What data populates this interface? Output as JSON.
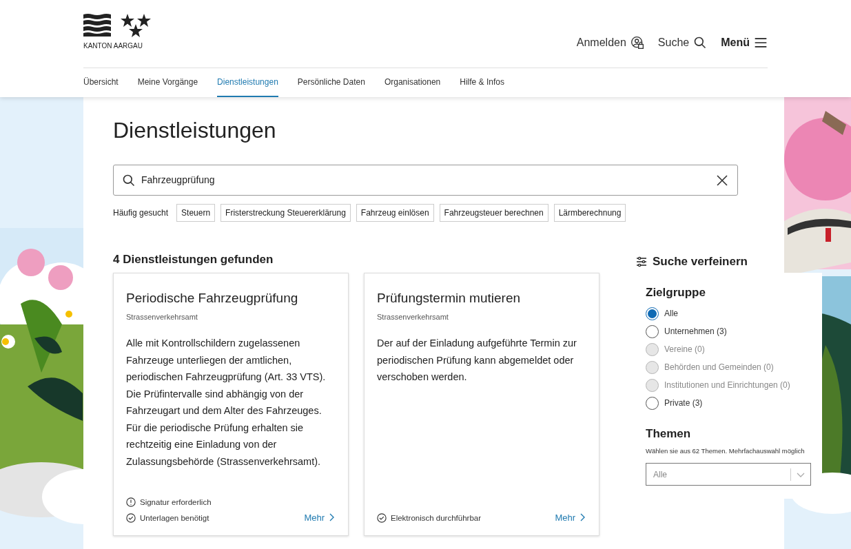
{
  "header": {
    "logo_text": "KANTON AARGAU",
    "actions": [
      {
        "kind": "login",
        "label": "Anmelden"
      },
      {
        "kind": "search",
        "label": "Suche"
      },
      {
        "kind": "menu",
        "label": "Menü"
      }
    ]
  },
  "nav": [
    {
      "label": "Übersicht",
      "selected": false
    },
    {
      "label": "Meine Vorgänge",
      "selected": false
    },
    {
      "label": "Dienstleistungen",
      "selected": true
    },
    {
      "label": "Persönliche Daten",
      "selected": false
    },
    {
      "label": "Organisationen",
      "selected": false
    },
    {
      "label": "Hilfe & Infos",
      "selected": false
    }
  ],
  "page_title": "Dienstleistungen",
  "search": {
    "value": "Fahrzeugprüfung"
  },
  "frequent": {
    "label": "Häufig gesucht",
    "tags": [
      "Steuern",
      "Fristerstreckung Steuererklärung",
      "Fahrzeug einlösen",
      "Fahrzeugsteuer berechnen",
      "Lärmberechnung"
    ]
  },
  "results_title": "4 Dienstleistungen gefunden",
  "cards": [
    {
      "title": "Periodische Fahrzeugprüfung",
      "office": "Strassenverkehrsamt",
      "text": "Alle mit Kontrollschildern zugelassenen Fahrzeuge unterliegen der amtlichen, periodischen Fahrzeugprüfung (Art. 33 VTS). Die Prüfintervalle sind abhängig von der Fahrzeugart und dem Alter des Fahrzeuges. Für die periodische Prüfung erhalten sie rechtzeitig eine Einladung von der Zulassungsbehörde (Strassenverkehrsamt).",
      "features": [
        {
          "kind": "warning",
          "label": "Signatur erforderlich"
        },
        {
          "kind": "check",
          "label": "Unterlagen benötigt"
        }
      ],
      "link": "Mehr"
    },
    {
      "title": "Prüfungstermin mutieren",
      "office": "Strassenverkehrsamt",
      "text": "Der auf der Einladung aufgeführte Termin zur periodischen Prüfung kann abgemeldet oder verschoben werden.",
      "features": [
        {
          "kind": "check",
          "label": "Elektronisch durchführbar"
        }
      ],
      "link": "Mehr"
    }
  ],
  "filter": {
    "title": "Suche verfeinern",
    "group_title": "Zielgruppe",
    "options": [
      {
        "label": "Alle",
        "selected": true,
        "disabled": false
      },
      {
        "label": "Unternehmen (3)",
        "selected": false,
        "disabled": false
      },
      {
        "label": "Vereine (0)",
        "selected": false,
        "disabled": true
      },
      {
        "label": "Behörden und Gemeinden (0)",
        "selected": false,
        "disabled": true
      },
      {
        "label": "Institutionen und Einrichtungen (0)",
        "selected": false,
        "disabled": true
      },
      {
        "label": "Private (3)",
        "selected": false,
        "disabled": false
      }
    ],
    "topics_title": "Themen",
    "topics_hint": "Wählen sie aus 62 Themen. Mehrfachauswahl möglich",
    "topics_select": "Alle"
  }
}
